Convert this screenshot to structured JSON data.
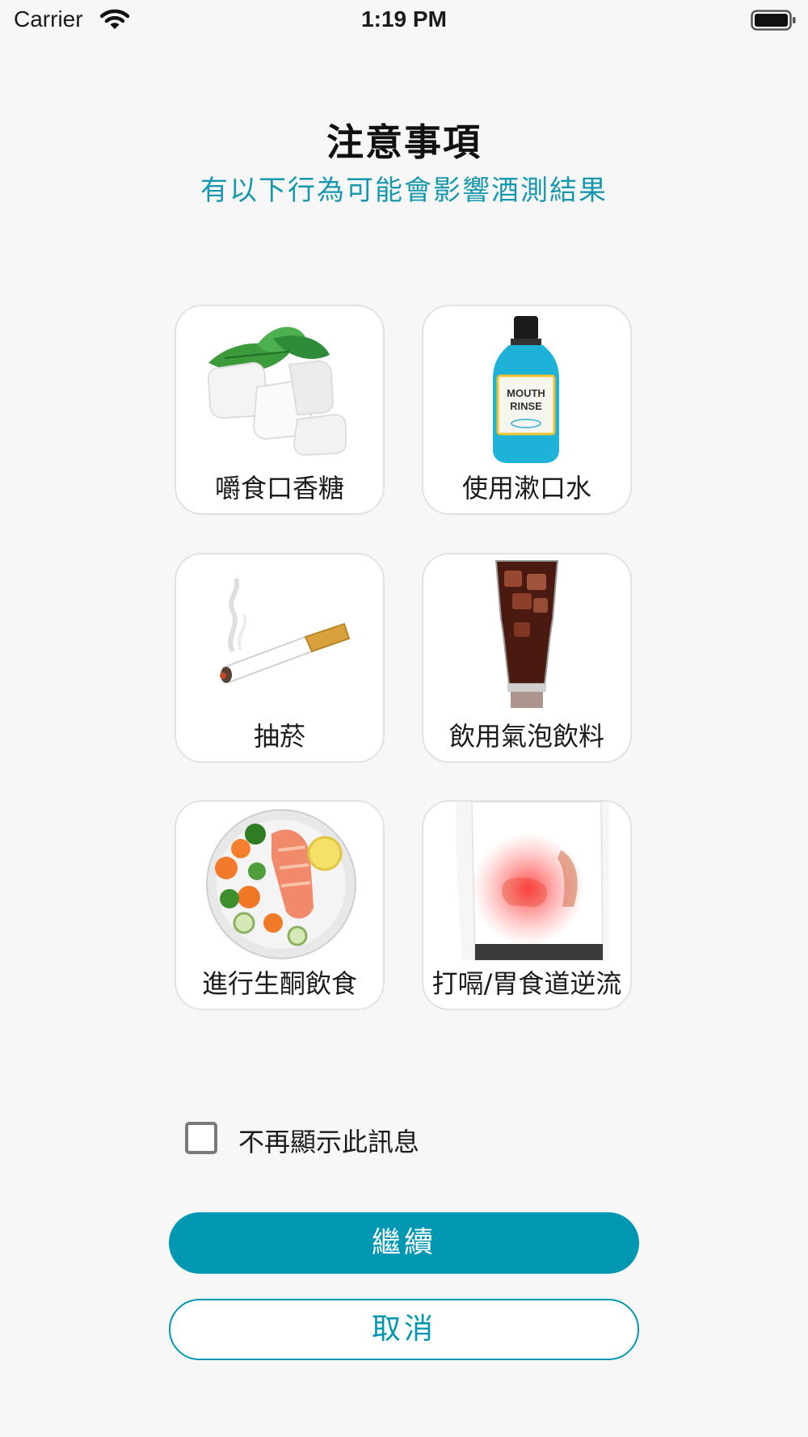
{
  "status_bar": {
    "carrier": "Carrier",
    "time": "1:19 PM"
  },
  "header": {
    "title": "注意事項",
    "subtitle": "有以下行為可能會影響酒測結果"
  },
  "items": [
    {
      "label": "嚼食口香糖",
      "icon": "chewing-gum-icon"
    },
    {
      "label": "使用漱口水",
      "icon": "mouthwash-icon",
      "bottle_text": "MOUTH RINSE"
    },
    {
      "label": "抽菸",
      "icon": "cigarette-icon"
    },
    {
      "label": "飲用氣泡飲料",
      "icon": "soda-glass-icon"
    },
    {
      "label": "進行生酮飲食",
      "icon": "keto-meal-icon"
    },
    {
      "label": "打嗝/胃食道逆流",
      "icon": "stomach-pain-icon"
    }
  ],
  "dont_show_again": {
    "label": "不再顯示此訊息",
    "checked": false
  },
  "buttons": {
    "continue": "繼續",
    "cancel": "取消"
  },
  "colors": {
    "accent": "#0097b2",
    "subtitle": "#1898ae",
    "background": "#f7f7f8"
  }
}
